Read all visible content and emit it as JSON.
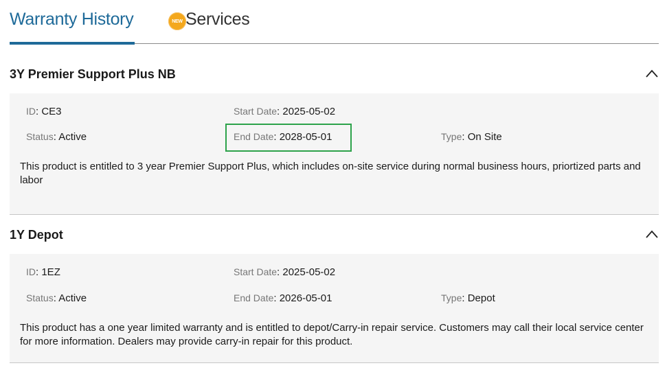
{
  "tabs": {
    "warranty_history": "Warranty History",
    "services": "Services",
    "new_badge": "NEW"
  },
  "warranties": [
    {
      "title": "3Y Premier Support Plus NB",
      "id_label": "ID",
      "id_value": "CE3",
      "start_label": "Start Date",
      "start_value": "2025-05-02",
      "status_label": "Status",
      "status_value": "Active",
      "end_label": "End Date",
      "end_value": "2028-05-01",
      "type_label": "Type",
      "type_value": "On Site",
      "description": "This product is entitled to 3 year Premier Support Plus, which includes on-site service during normal business hours, priortized parts and labor"
    },
    {
      "title": "1Y Depot",
      "id_label": "ID",
      "id_value": "1EZ",
      "start_label": "Start Date",
      "start_value": "2025-05-02",
      "status_label": "Status",
      "status_value": "Active",
      "end_label": "End Date",
      "end_value": "2026-05-01",
      "type_label": "Type",
      "type_value": "Depot",
      "description": "This product has a one year limited warranty and is entitled to depot/Carry-in repair service. Customers may call their local service center for more information. Dealers may provide carry-in repair for this product."
    }
  ],
  "colors": {
    "accent": "#1e6a99",
    "badge": "#f4a81d",
    "highlight": "#2ca24a",
    "panel_bg": "#f5f5f5"
  }
}
